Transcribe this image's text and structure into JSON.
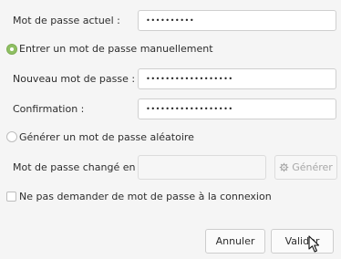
{
  "current_password": {
    "label": "Mot de passe actuel :",
    "value": "••••••••••"
  },
  "mode_manual": {
    "label": "Entrer un mot de passe manuellement",
    "selected": true
  },
  "new_password": {
    "label": "Nouveau mot de passe :",
    "value": "••••••••••••••••••"
  },
  "confirmation": {
    "label": "Confirmation :",
    "value": "••••••••••••••••••"
  },
  "mode_random": {
    "label": "Générer un mot de passe aléatoire",
    "selected": false
  },
  "generated": {
    "label": "Mot de passe changé en :",
    "value": "",
    "generate_label": "Générer"
  },
  "no_login_password": {
    "label": "Ne pas demander de mot de passe à la connexion",
    "checked": false
  },
  "actions": {
    "cancel_label": "Annuler",
    "validate_label": "Valider"
  },
  "colors": {
    "accent": "#8fbf63",
    "background": "#f5f5f5"
  },
  "icons": {
    "generate": "gear-icon",
    "pointer": "mouse-pointer-icon"
  }
}
